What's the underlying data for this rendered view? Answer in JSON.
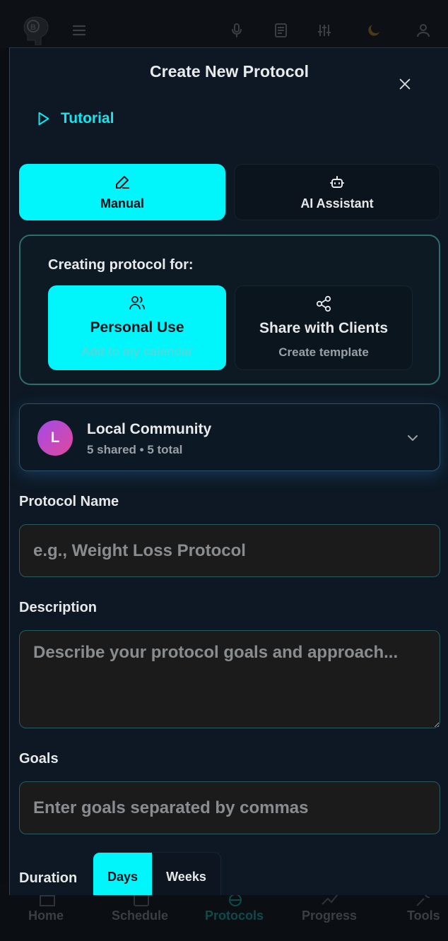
{
  "topbar": {
    "icons": [
      "brain-logo",
      "menu-icon",
      "microphone-icon",
      "news-icon",
      "sliders-icon",
      "moon-icon",
      "user-icon"
    ]
  },
  "modal": {
    "title": "Create New Protocol",
    "tutorial_label": "Tutorial",
    "modes": [
      {
        "label": "Manual",
        "icon": "pencil-icon",
        "selected": true
      },
      {
        "label": "AI Assistant",
        "icon": "bot-icon",
        "selected": false
      }
    ],
    "creating_for": {
      "title": "Creating protocol for:",
      "options": [
        {
          "title": "Personal Use",
          "subtitle": "Add to my calendar",
          "icon": "users-icon",
          "selected": true
        },
        {
          "title": "Share with Clients",
          "subtitle": "Create template",
          "icon": "share-icon",
          "selected": false
        }
      ]
    },
    "community": {
      "avatar_letter": "L",
      "name": "Local Community",
      "subtitle": "5 shared • 5 total"
    },
    "fields": {
      "name_label": "Protocol Name",
      "name_placeholder": "e.g., Weight Loss Protocol",
      "name_value": "",
      "description_label": "Description",
      "description_placeholder": "Describe your protocol goals and approach...",
      "description_value": "",
      "goals_label": "Goals",
      "goals_placeholder": "Enter goals separated by commas",
      "goals_value": ""
    },
    "duration": {
      "label": "Duration",
      "options": [
        "Days",
        "Weeks"
      ],
      "selected": "Days"
    }
  },
  "bottom_nav": {
    "items": [
      "Home",
      "Schedule",
      "Protocols",
      "Progress",
      "Tools"
    ],
    "active": "Protocols"
  },
  "colors": {
    "accent": "#00f6fb",
    "modal_bg": "#0d1824",
    "avatar_gradient": [
      "#a24be9",
      "#e0489b"
    ]
  }
}
